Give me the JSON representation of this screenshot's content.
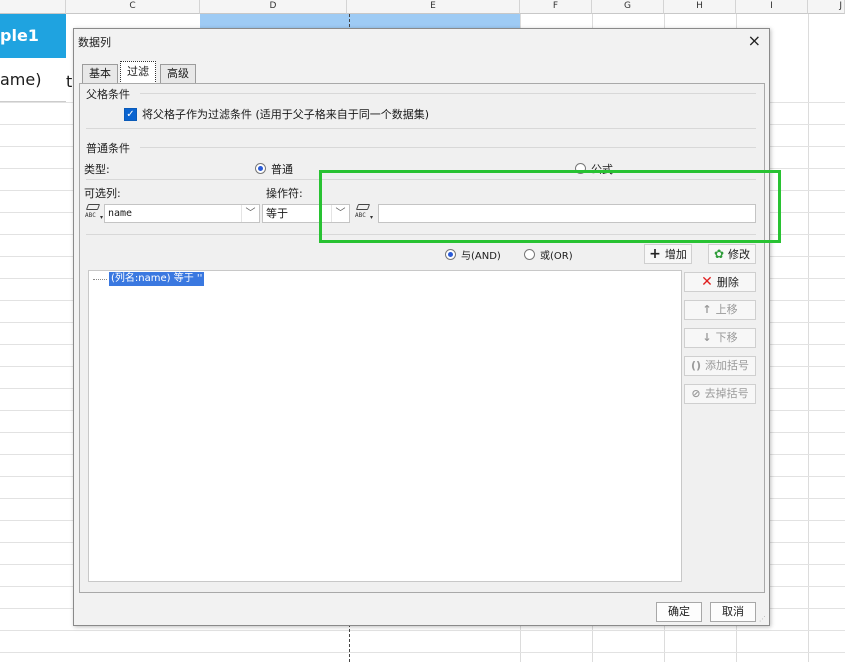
{
  "spreadsheet": {
    "columns": [
      "C",
      "D",
      "E",
      "F",
      "G",
      "H",
      "I",
      "J"
    ],
    "table_title_fragment": "ple1",
    "cell_fragment": "ame)",
    "cell_fragment2": "t"
  },
  "dialog": {
    "title": "数据列",
    "close_glyph": "×",
    "tabs": [
      {
        "label": "基本",
        "active": false
      },
      {
        "label": "过滤",
        "active": true
      },
      {
        "label": "高级",
        "active": false
      }
    ],
    "parent_section": {
      "title": "父格条件",
      "checkbox_label": "将父格子作为过滤条件 (适用于父子格来自于同一个数据集)",
      "checked": true
    },
    "general_section": {
      "title": "普通条件",
      "type_label": "类型:",
      "type_options": [
        {
          "label": "普通",
          "selected": true
        },
        {
          "label": "公式",
          "selected": false
        }
      ],
      "column_label": "可选列:",
      "operator_label": "操作符:",
      "column_value": "name",
      "operator_value": "等于",
      "value_input": ""
    },
    "logic_options": [
      {
        "label": "与(AND)",
        "selected": true
      },
      {
        "label": "或(OR)",
        "selected": false
      }
    ],
    "conditions": [
      {
        "text": "(列名:name) 等于 ''",
        "selected": true
      }
    ],
    "buttons": {
      "add": {
        "label": "增加",
        "icon": "plus-icon"
      },
      "modify": {
        "label": "修改",
        "icon": "gear-icon"
      },
      "delete": {
        "label": "删除",
        "icon": "delete-x-icon"
      },
      "move_up": {
        "label": "上移",
        "icon": "arrow-up-icon",
        "disabled": true
      },
      "move_down": {
        "label": "下移",
        "icon": "arrow-down-icon",
        "disabled": true
      },
      "add_bracket": {
        "label": "添加括号",
        "icon": "bracket-icon",
        "disabled": true
      },
      "remove_bracket": {
        "label": "去掉括号",
        "icon": "remove-bracket-icon",
        "disabled": true
      }
    },
    "footer": {
      "ok_label": "确定",
      "cancel_label": "取消"
    }
  },
  "colors": {
    "highlight_box": "#28c232",
    "selection": "#3a78e0",
    "table_header": "#1fa3e0",
    "checkbox": "#0a64d0"
  }
}
